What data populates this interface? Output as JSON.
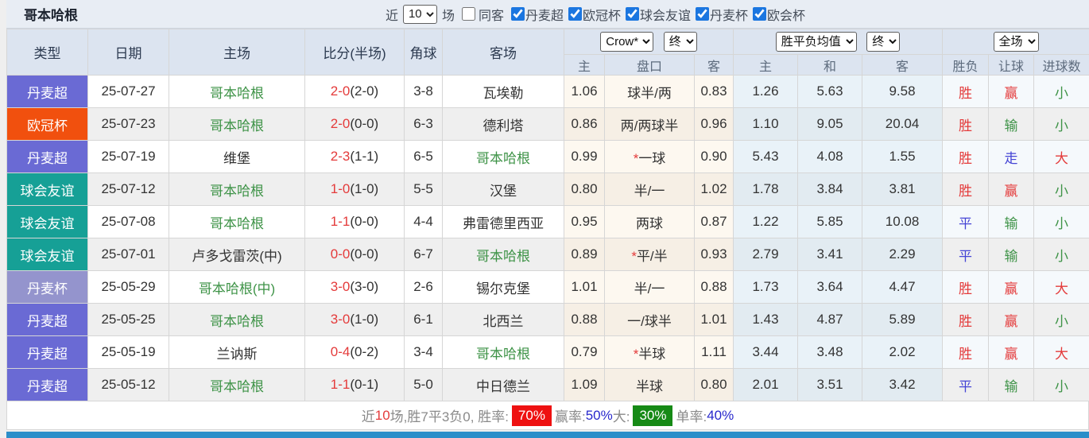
{
  "page": {
    "title": "哥本哈根",
    "topbar": {
      "recent_label": "近",
      "recent_value": "10",
      "matches_label": "场",
      "same_venue_label": "同客",
      "same_venue_checked": false,
      "leagues": [
        {
          "label": "丹麦超",
          "checked": true
        },
        {
          "label": "欧冠杯",
          "checked": true
        },
        {
          "label": "球会友谊",
          "checked": true
        },
        {
          "label": "丹麦杯",
          "checked": true
        },
        {
          "label": "欧会杯",
          "checked": true
        }
      ]
    }
  },
  "table": {
    "headers": {
      "type": "类型",
      "date": "日期",
      "home": "主场",
      "score": "比分(半场)",
      "corner": "角球",
      "away": "客场",
      "asia_home": "主",
      "asia_handicap": "盘口",
      "asia_away": "客",
      "euro_home": "主",
      "euro_draw": "和",
      "euro_away": "客",
      "result": "胜负",
      "handicap_result": "让球",
      "goals": "进球数"
    },
    "selects": {
      "asia_provider": "Crow*",
      "asia_time": "终",
      "euro_provider": "胜平负均值",
      "euro_time": "终",
      "period": "全场"
    },
    "rows": [
      {
        "type": "丹麦超",
        "type_key": "dc",
        "date": "25-07-27",
        "home": "哥本哈根",
        "home_team": true,
        "score": "2-0",
        "half": "(2-0)",
        "corner": "3-8",
        "away": "瓦埃勒",
        "away_team": false,
        "asia_home": "1.06",
        "handicap": "球半/两",
        "star": false,
        "asia_away": "0.83",
        "euro_home": "1.26",
        "euro_draw": "5.63",
        "euro_away": "9.58",
        "result": "胜",
        "result_color": "red",
        "hres": "赢",
        "hres_color": "red",
        "goals": "小",
        "goals_color": "green"
      },
      {
        "type": "欧冠杯",
        "type_key": "ucl",
        "date": "25-07-23",
        "home": "哥本哈根",
        "home_team": true,
        "score": "2-0",
        "half": "(0-0)",
        "corner": "6-3",
        "away": "德利塔",
        "away_team": false,
        "asia_home": "0.86",
        "handicap": "两/两球半",
        "star": false,
        "asia_away": "0.96",
        "euro_home": "1.10",
        "euro_draw": "9.05",
        "euro_away": "20.04",
        "result": "胜",
        "result_color": "red",
        "hres": "输",
        "hres_color": "green",
        "goals": "小",
        "goals_color": "green"
      },
      {
        "type": "丹麦超",
        "type_key": "dc",
        "date": "25-07-19",
        "home": "维堡",
        "home_team": false,
        "score": "2-3",
        "half": "(1-1)",
        "corner": "6-5",
        "away": "哥本哈根",
        "away_team": true,
        "asia_home": "0.99",
        "handicap": "一球",
        "star": true,
        "asia_away": "0.90",
        "euro_home": "5.43",
        "euro_draw": "4.08",
        "euro_away": "1.55",
        "result": "胜",
        "result_color": "red",
        "hres": "走",
        "hres_color": "blue",
        "goals": "大",
        "goals_color": "red"
      },
      {
        "type": "球会友谊",
        "type_key": "fr",
        "date": "25-07-12",
        "home": "哥本哈根",
        "home_team": true,
        "score": "1-0",
        "half": "(1-0)",
        "corner": "5-5",
        "away": "汉堡",
        "away_team": false,
        "asia_home": "0.80",
        "handicap": "半/一",
        "star": false,
        "asia_away": "1.02",
        "euro_home": "1.78",
        "euro_draw": "3.84",
        "euro_away": "3.81",
        "result": "胜",
        "result_color": "red",
        "hres": "赢",
        "hres_color": "red",
        "goals": "小",
        "goals_color": "green"
      },
      {
        "type": "球会友谊",
        "type_key": "fr",
        "date": "25-07-08",
        "home": "哥本哈根",
        "home_team": true,
        "score": "1-1",
        "half": "(0-0)",
        "corner": "4-4",
        "away": "弗雷德里西亚",
        "away_team": false,
        "asia_home": "0.95",
        "handicap": "两球",
        "star": false,
        "asia_away": "0.87",
        "euro_home": "1.22",
        "euro_draw": "5.85",
        "euro_away": "10.08",
        "result": "平",
        "result_color": "blue",
        "hres": "输",
        "hres_color": "green",
        "goals": "小",
        "goals_color": "green"
      },
      {
        "type": "球会友谊",
        "type_key": "fr",
        "date": "25-07-01",
        "home": "卢多戈雷茨(中)",
        "home_team": false,
        "score": "0-0",
        "half": "(0-0)",
        "corner": "6-7",
        "away": "哥本哈根",
        "away_team": true,
        "asia_home": "0.89",
        "handicap": "平/半",
        "star": true,
        "asia_away": "0.93",
        "euro_home": "2.79",
        "euro_draw": "3.41",
        "euro_away": "2.29",
        "result": "平",
        "result_color": "blue",
        "hres": "输",
        "hres_color": "green",
        "goals": "小",
        "goals_color": "green"
      },
      {
        "type": "丹麦杯",
        "type_key": "cup",
        "date": "25-05-29",
        "home": "哥本哈根(中)",
        "home_team": true,
        "score": "3-0",
        "half": "(3-0)",
        "corner": "2-6",
        "away": "锡尔克堡",
        "away_team": false,
        "asia_home": "1.01",
        "handicap": "半/一",
        "star": false,
        "asia_away": "0.88",
        "euro_home": "1.73",
        "euro_draw": "3.64",
        "euro_away": "4.47",
        "result": "胜",
        "result_color": "red",
        "hres": "赢",
        "hres_color": "red",
        "goals": "大",
        "goals_color": "red"
      },
      {
        "type": "丹麦超",
        "type_key": "dc",
        "date": "25-05-25",
        "home": "哥本哈根",
        "home_team": true,
        "score": "3-0",
        "half": "(1-0)",
        "corner": "6-1",
        "away": "北西兰",
        "away_team": false,
        "asia_home": "0.88",
        "handicap": "一/球半",
        "star": false,
        "asia_away": "1.01",
        "euro_home": "1.43",
        "euro_draw": "4.87",
        "euro_away": "5.89",
        "result": "胜",
        "result_color": "red",
        "hres": "赢",
        "hres_color": "red",
        "goals": "小",
        "goals_color": "green"
      },
      {
        "type": "丹麦超",
        "type_key": "dc",
        "date": "25-05-19",
        "home": "兰讷斯",
        "home_team": false,
        "score": "0-4",
        "half": "(0-2)",
        "corner": "3-4",
        "away": "哥本哈根",
        "away_team": true,
        "asia_home": "0.79",
        "handicap": "半球",
        "star": true,
        "asia_away": "1.11",
        "euro_home": "3.44",
        "euro_draw": "3.48",
        "euro_away": "2.02",
        "result": "胜",
        "result_color": "red",
        "hres": "赢",
        "hres_color": "red",
        "goals": "大",
        "goals_color": "red"
      },
      {
        "type": "丹麦超",
        "type_key": "dc",
        "date": "25-05-12",
        "home": "哥本哈根",
        "home_team": true,
        "score": "1-1",
        "half": "(0-1)",
        "corner": "5-0",
        "away": "中日德兰",
        "away_team": false,
        "asia_home": "1.09",
        "handicap": "半球",
        "star": false,
        "asia_away": "0.80",
        "euro_home": "2.01",
        "euro_draw": "3.51",
        "euro_away": "3.42",
        "result": "平",
        "result_color": "blue",
        "hres": "输",
        "hres_color": "green",
        "goals": "小",
        "goals_color": "green"
      }
    ]
  },
  "footer": {
    "segments": [
      {
        "text": "近",
        "style": "gray"
      },
      {
        "text": "10",
        "style": "red"
      },
      {
        "text": "场,胜7平3负0, 胜率: ",
        "style": "gray"
      },
      {
        "text": "70%",
        "style": "badge-red"
      },
      {
        "text": " 赢率:",
        "style": "gray"
      },
      {
        "text": "50%",
        "style": "blue"
      },
      {
        "text": " 大: ",
        "style": "gray"
      },
      {
        "text": "30%",
        "style": "badge-green"
      },
      {
        "text": " 单率:",
        "style": "gray"
      },
      {
        "text": "40%",
        "style": "blue"
      }
    ]
  },
  "colors": {
    "league": {
      "dc": "#6a6ad4",
      "ucl": "#f1500e",
      "fr": "#16a096",
      "cup": "#9494cd"
    },
    "status": {
      "red": "#e43b3b",
      "green": "#3e9347",
      "blue": "#4545d5"
    },
    "team_green": "#3e9347",
    "score_red": "#e43b3b",
    "star_red": "#e43b3b",
    "footer": {
      "gray": "#8a8a8a",
      "red": "#e43b3b",
      "blue": "#2727cc",
      "badge_red_bg": "#ee1111",
      "badge_green_bg": "#168a16",
      "badge_text": "#ffffff"
    },
    "bottom_bar": "#2b8ec9"
  }
}
